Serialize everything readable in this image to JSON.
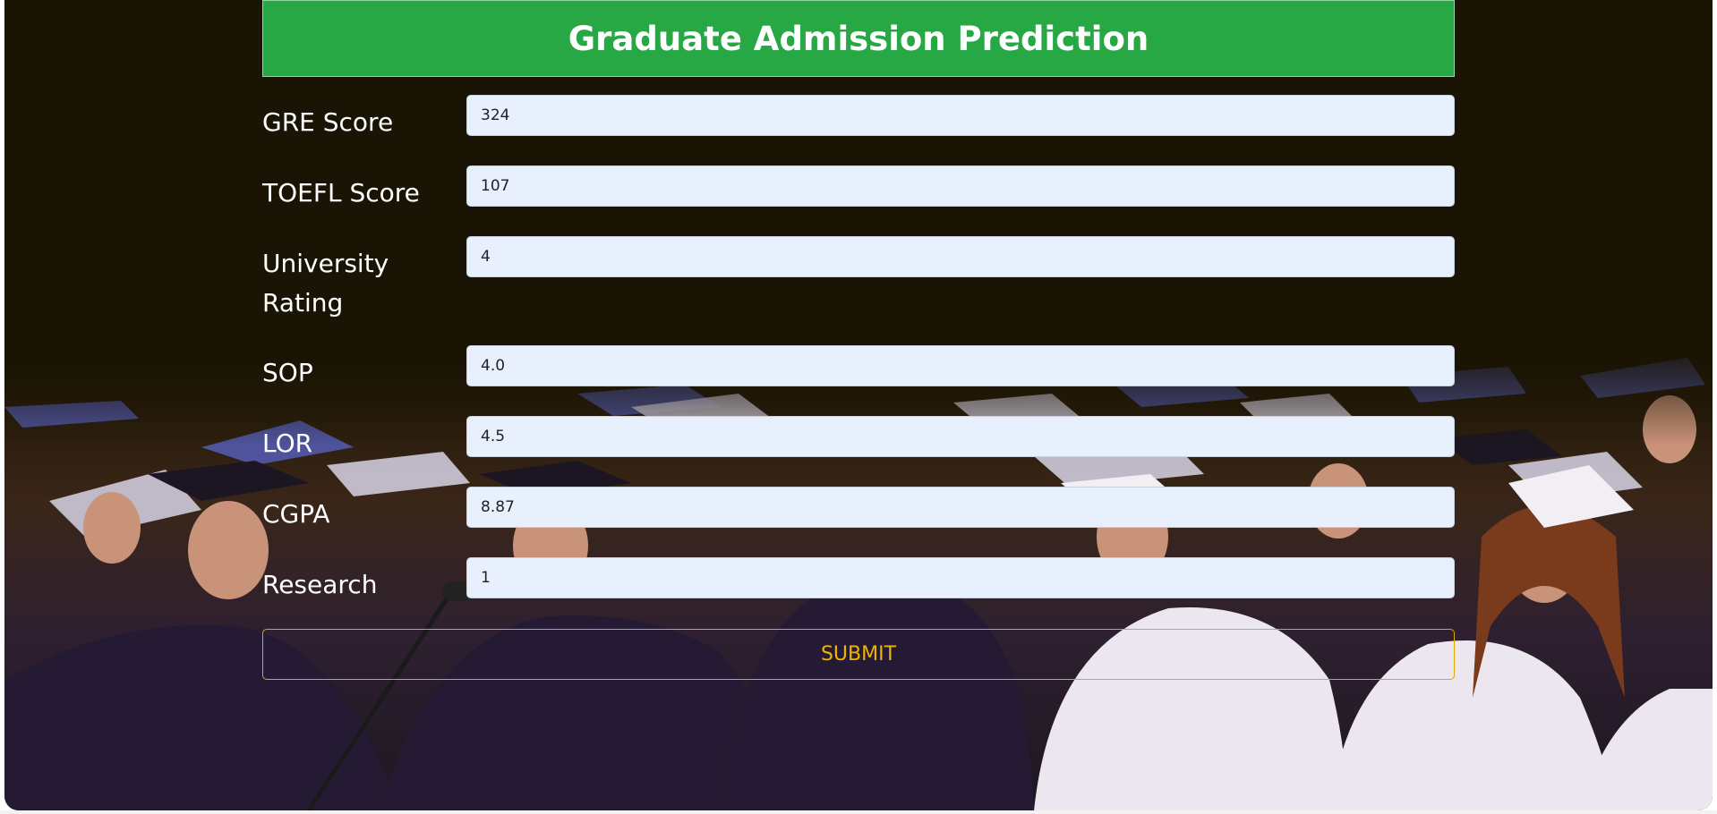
{
  "header": {
    "title": "Graduate Admission Prediction"
  },
  "form": {
    "fields": [
      {
        "label": "GRE Score",
        "value": "324"
      },
      {
        "label": "TOEFL Score",
        "value": "107"
      },
      {
        "label": "University Rating",
        "value": "4"
      },
      {
        "label": "SOP",
        "value": "4.0"
      },
      {
        "label": "LOR",
        "value": "4.5"
      },
      {
        "label": "CGPA",
        "value": "8.87"
      },
      {
        "label": "Research",
        "value": "1"
      }
    ],
    "submit_label": "SUBMIT"
  },
  "colors": {
    "header_background": "#27a844",
    "submit_accent": "#f0b400",
    "input_background": "#e8f0fe"
  }
}
